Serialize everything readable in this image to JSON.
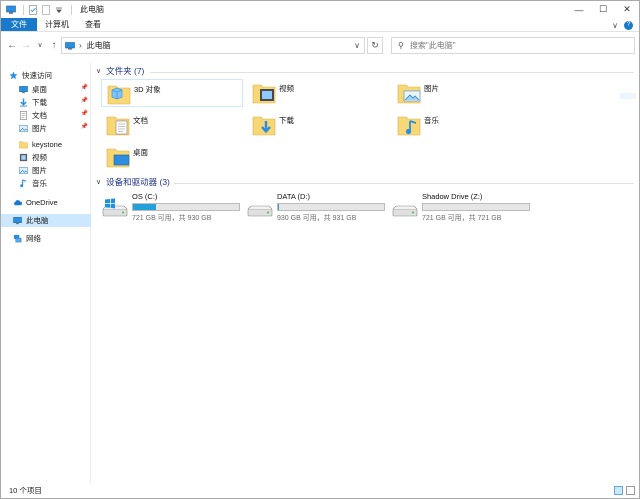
{
  "window": {
    "title": "此电脑",
    "caption": {
      "minimize": "—",
      "maximize": "☐",
      "close": "✕"
    }
  },
  "ribbon": {
    "tabs": [
      {
        "label": "文件",
        "active": true
      },
      {
        "label": "计算机"
      },
      {
        "label": "查看"
      }
    ],
    "expand_icon": "chevron-down-icon",
    "help_icon": "help-icon",
    "help_text": "?"
  },
  "address": {
    "back": "←",
    "forward": "→",
    "recent": "∨",
    "up": "↑",
    "breadcrumb_sep": "›",
    "breadcrumb": "此电脑",
    "dropdown": "∨",
    "refresh": "↻",
    "search_placeholder": "搜索\"此电脑\""
  },
  "nav": {
    "items": [
      {
        "label": "快速访问",
        "icon": "star-icon",
        "pinned": false
      },
      {
        "label": "桌面",
        "icon": "desktop-icon",
        "pinned": true
      },
      {
        "label": "下载",
        "icon": "download-icon",
        "pinned": true
      },
      {
        "label": "文档",
        "icon": "documents-icon",
        "pinned": true
      },
      {
        "label": "图片",
        "icon": "pictures-icon",
        "pinned": true
      },
      {
        "label": "keystone",
        "icon": "folder-icon",
        "pinned": false
      },
      {
        "label": "视频",
        "icon": "videos-icon",
        "pinned": false
      },
      {
        "label": "图片",
        "icon": "pictures-icon",
        "pinned": false
      },
      {
        "label": "音乐",
        "icon": "music-icon",
        "pinned": false
      },
      {
        "label": "OneDrive",
        "icon": "cloud-icon",
        "pinned": false
      },
      {
        "label": "此电脑",
        "icon": "this-pc-icon",
        "pinned": false,
        "selected": true
      },
      {
        "label": "网络",
        "icon": "network-icon",
        "pinned": false
      }
    ],
    "pin_glyph": "📌"
  },
  "folders": {
    "header": "文件夹 (7)",
    "items": [
      {
        "label": "3D 对象",
        "icon": "3d-objects-folder-icon",
        "selected": true
      },
      {
        "label": "视频",
        "icon": "videos-folder-icon"
      },
      {
        "label": "图片",
        "icon": "pictures-folder-icon"
      },
      {
        "label": "文档",
        "icon": "documents-folder-icon"
      },
      {
        "label": "下载",
        "icon": "downloads-folder-icon"
      },
      {
        "label": "音乐",
        "icon": "music-folder-icon"
      },
      {
        "label": "桌面",
        "icon": "desktop-folder-icon"
      }
    ]
  },
  "drives": {
    "header": "设备和驱动器 (3)",
    "items": [
      {
        "name": "OS (C:)",
        "usage": "721 GB 可用，共 930 GB",
        "used_fraction": 0.22,
        "icon": "windows-drive-icon"
      },
      {
        "name": "DATA (D:)",
        "usage": "930 GB 可用，共 931 GB",
        "used_fraction": 0.001,
        "icon": "drive-icon"
      },
      {
        "name": "Shadow Drive (Z:)",
        "usage": "721 GB 可用，共 721 GB",
        "used_fraction": 0.0,
        "icon": "drive-icon"
      }
    ]
  },
  "status": {
    "count": "10 个项目"
  },
  "colors": {
    "accent": "#1979ca",
    "folder": "#f8d775",
    "bar_fill": "#26a0da",
    "header_text": "#1e3287"
  }
}
